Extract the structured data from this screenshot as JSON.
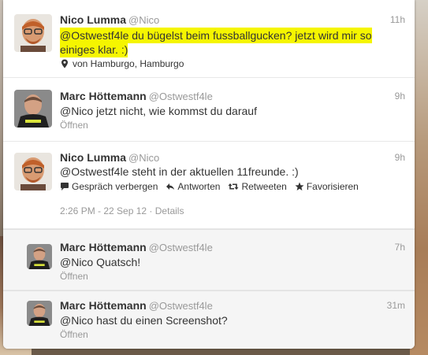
{
  "tweets": [
    {
      "name": "Nico Lumma",
      "handle": "@Nico",
      "time": "11h",
      "text": "@Ostwestf4le du bügelst beim fussballgucken? jetzt wird mir so einiges klar. :)",
      "mention": "@Ostwestf4le",
      "rest_line1": " du bügelst beim fussballgucken? jetzt wird mir so",
      "rest_line2": "einiges klar. :)",
      "location": "von Hamburgo, Hamburgo",
      "location_icon": "map-pin-icon"
    },
    {
      "name": "Marc Höttemann",
      "handle": "@Ostwestf4le",
      "time": "9h",
      "text": "@Nico jetzt nicht, wie kommst du darauf",
      "open_label": "Öffnen"
    },
    {
      "name": "Nico Lumma",
      "handle": "@Nico",
      "time": "9h",
      "text": "@Ostwestf4le steht in der aktuellen 11freunde. :)",
      "actions": [
        {
          "icon": "speech-bubble-icon",
          "label": "Gespräch verbergen"
        },
        {
          "icon": "reply-arrow-icon",
          "label": "Antworten"
        },
        {
          "icon": "retweet-icon",
          "label": "Retweeten"
        },
        {
          "icon": "star-icon",
          "label": "Favorisieren"
        }
      ],
      "timestamp": "2:26 PM - 22 Sep 12",
      "separator": "·",
      "details_label": "Details"
    },
    {
      "name": "Marc Höttemann",
      "handle": "@Ostwestf4le",
      "time": "7h",
      "text": "@Nico Quatsch!",
      "open_label": "Öffnen"
    },
    {
      "name": "Marc Höttemann",
      "handle": "@Ostwestf4le",
      "time": "31m",
      "text": "@Nico hast du einen Screenshot?",
      "open_label": "Öffnen"
    }
  ],
  "colors": {
    "highlight": "#f5f500",
    "name": "#333333",
    "muted": "#999999",
    "reply_bg": "#f5f5f5"
  }
}
